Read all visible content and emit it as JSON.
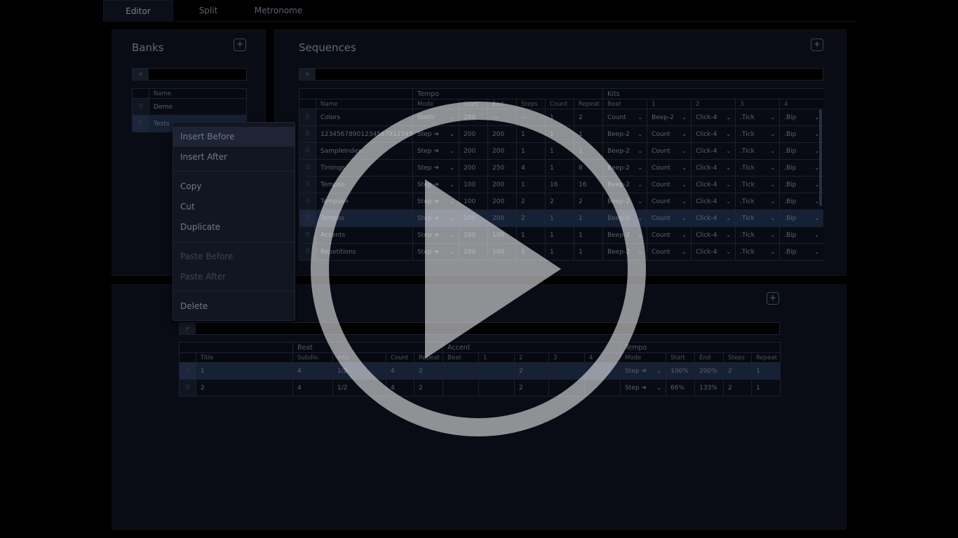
{
  "tabs": [
    {
      "label": "Editor"
    },
    {
      "label": "Split"
    },
    {
      "label": "Metronome"
    }
  ],
  "banks": {
    "title": "Banks",
    "add": "+",
    "search_icon": "⌕",
    "col_name": "Name",
    "items": [
      "Demo",
      "Tests"
    ],
    "grip": "⠿"
  },
  "sequences": {
    "title": "Sequences",
    "add": "+",
    "search_icon": "⌕",
    "groups": {
      "tempo": "Tempo",
      "kits": "Kits"
    },
    "cols": [
      "Name",
      "Mode",
      "Start",
      "End",
      "Steps",
      "Count",
      "Repeat",
      "Beat",
      "1",
      "2",
      "3",
      "4"
    ],
    "rows": [
      [
        "Colors",
        "Static",
        "200",
        "—",
        "—",
        "1",
        "2",
        "Count",
        "Beep-2",
        "Click-4",
        ".Tick",
        ".Bip"
      ],
      [
        "12345678901234567812345678",
        "Step ➔",
        "200",
        "200",
        "1",
        "1",
        "1",
        "Beep-2",
        "Count",
        "Click-4",
        ".Tick",
        ".Bip"
      ],
      [
        "SampleIndex",
        "Step ➔",
        "200",
        "200",
        "1",
        "1",
        "1",
        "Beep-2",
        "Count",
        "Click-4",
        ".Tick",
        ".Bip"
      ],
      [
        "Timings",
        "Step ➔",
        "200",
        "250",
        "4",
        "1",
        "8",
        "Beep-2",
        "Count",
        "Click-4",
        ".Tick",
        ".Bip"
      ],
      [
        "Tempos-",
        "Step ➔",
        "100",
        "200",
        "1",
        "16",
        "16",
        "Beep-2",
        "Count",
        "Click-4",
        ".Tick",
        ".Bip"
      ],
      [
        "Tempos+",
        "Step ➔",
        "100",
        "200",
        "2",
        "2",
        "2",
        "Beep-2",
        "Count",
        "Click-4",
        ".Tick",
        ".Bip"
      ],
      [
        "Tempos",
        "Step ➔",
        "100",
        "200",
        "2",
        "1",
        "1",
        "Beep-2",
        "Count",
        "Click-4",
        ".Tick",
        ".Bip"
      ],
      [
        "Accents",
        "Step ➔",
        "100",
        "100",
        "1",
        "1",
        "1",
        "Beep-2",
        "Count",
        "Click-4",
        ".Tick",
        ".Bip"
      ],
      [
        "Repetitions",
        "Step ➔",
        "100",
        "100",
        "1",
        "1",
        "1",
        "Beep-2",
        "Count",
        "Click-4",
        ".Tick",
        ".Bip"
      ]
    ]
  },
  "steps": {
    "add": "+",
    "search_icon": "⌕",
    "groups": {
      "beat": "Beat",
      "accent": "Accent",
      "tempo": "Tempo"
    },
    "cols": [
      "Title",
      "Subdiv.",
      "Into",
      "Count",
      "Repeat",
      "Beat",
      "1",
      "2",
      "3",
      "4",
      "Mode",
      "Start",
      "End",
      "Steps",
      "Repeat"
    ],
    "rows": [
      [
        "1",
        "4",
        "1/2",
        "4",
        "2",
        "",
        "",
        "2",
        "",
        "",
        "Step ➔",
        "100%",
        "200%",
        "2",
        "1"
      ],
      [
        "2",
        "4",
        "1/2",
        "4",
        "2",
        "",
        "",
        "2",
        "",
        "",
        "Step ➔",
        "66%",
        "133%",
        "2",
        "1"
      ]
    ]
  },
  "menu": {
    "items": [
      "Insert Before",
      "Insert After",
      "Copy",
      "Cut",
      "Duplicate",
      "Paste Before",
      "Paste After",
      "Delete"
    ]
  },
  "chevron": "⌄",
  "colors": {
    "play_overlay": "#ffffff",
    "selected_row": "#243352",
    "background": "#0e1320"
  }
}
